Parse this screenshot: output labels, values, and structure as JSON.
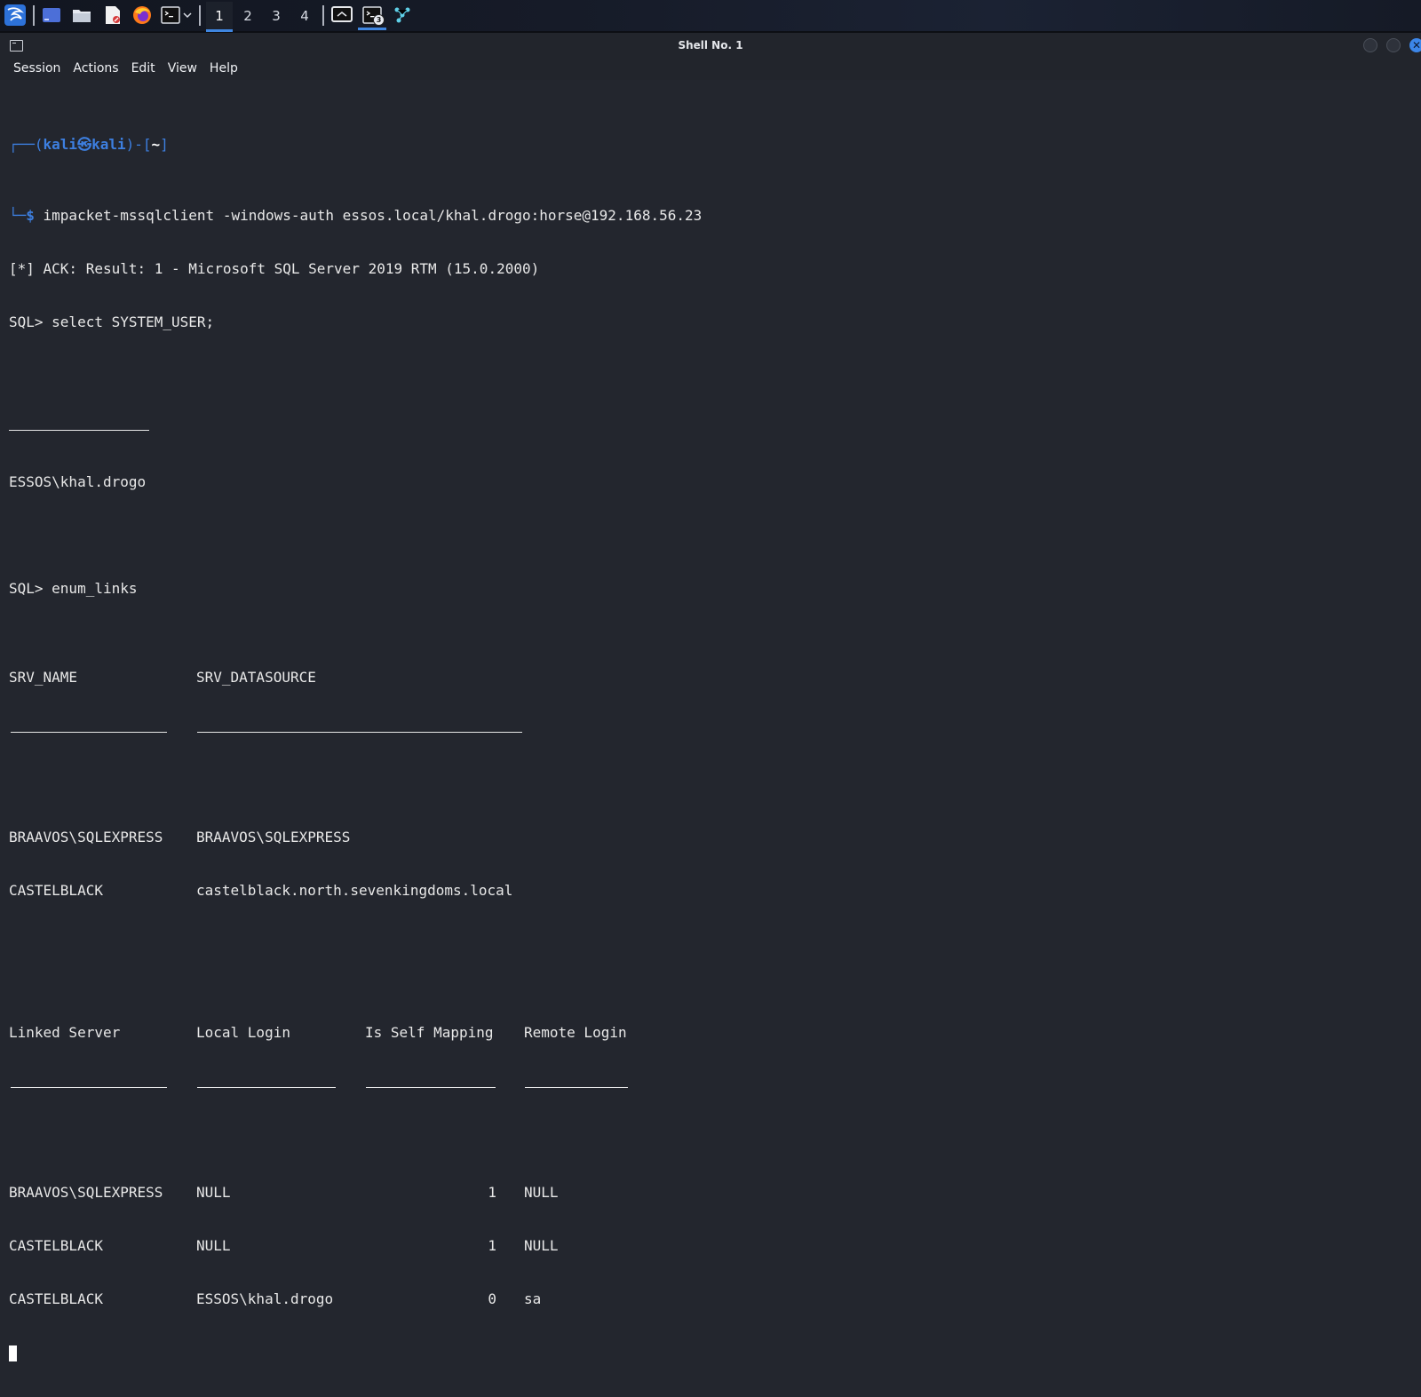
{
  "taskbar": {
    "workspaces": [
      "1",
      "2",
      "3",
      "4"
    ],
    "active_workspace": "1",
    "terminal_badge": "3",
    "icons": [
      "kali-dragon-icon",
      "desktop-icon",
      "file-manager-icon",
      "text-editor-icon",
      "firefox-icon",
      "terminal-icon",
      "chevron-down-icon",
      "screen-icon",
      "terminal-window-icon",
      "network-graph-icon"
    ]
  },
  "window": {
    "title": "Shell No. 1",
    "menu": [
      "Session",
      "Actions",
      "Edit",
      "View",
      "Help"
    ]
  },
  "terminal": {
    "prompt": {
      "open": "┌──(",
      "user": "kali",
      "at": "㉿",
      "host": "kali",
      "close": ")-[",
      "dir": "~",
      "end": "]",
      "second": "└─",
      "dollar": "$ "
    },
    "command": "impacket-mssqlclient -windows-auth essos.local/khal.drogo:horse@192.168.56.23",
    "ack": "[*] ACK: Result: 1 - Microsoft SQL Server 2019 RTM (15.0.2000)",
    "sql1": "SQL> select SYSTEM_USER;",
    "system_user": "ESSOS\\khal.drogo",
    "sql2": "SQL> enum_links",
    "links_table": {
      "headers": [
        "SRV_NAME",
        "SRV_DATASOURCE"
      ],
      "rows": [
        [
          "BRAAVOS\\SQLEXPRESS",
          "BRAAVOS\\SQLEXPRESS"
        ],
        [
          "CASTELBLACK",
          "castelblack.north.sevenkingdoms.local"
        ]
      ]
    },
    "logins_table": {
      "headers": [
        "Linked Server",
        "Local Login",
        "Is Self Mapping",
        "Remote Login"
      ],
      "rows": [
        [
          "BRAAVOS\\SQLEXPRESS",
          "NULL",
          "1",
          "NULL"
        ],
        [
          "CASTELBLACK",
          "NULL",
          "1",
          "NULL"
        ],
        [
          "CASTELBLACK",
          "ESSOS\\khal.drogo",
          "0",
          "sa"
        ]
      ]
    }
  },
  "colors": {
    "background": "#23262e",
    "prompt_blue": "#3d7fe0",
    "text": "#e8e8e8"
  }
}
